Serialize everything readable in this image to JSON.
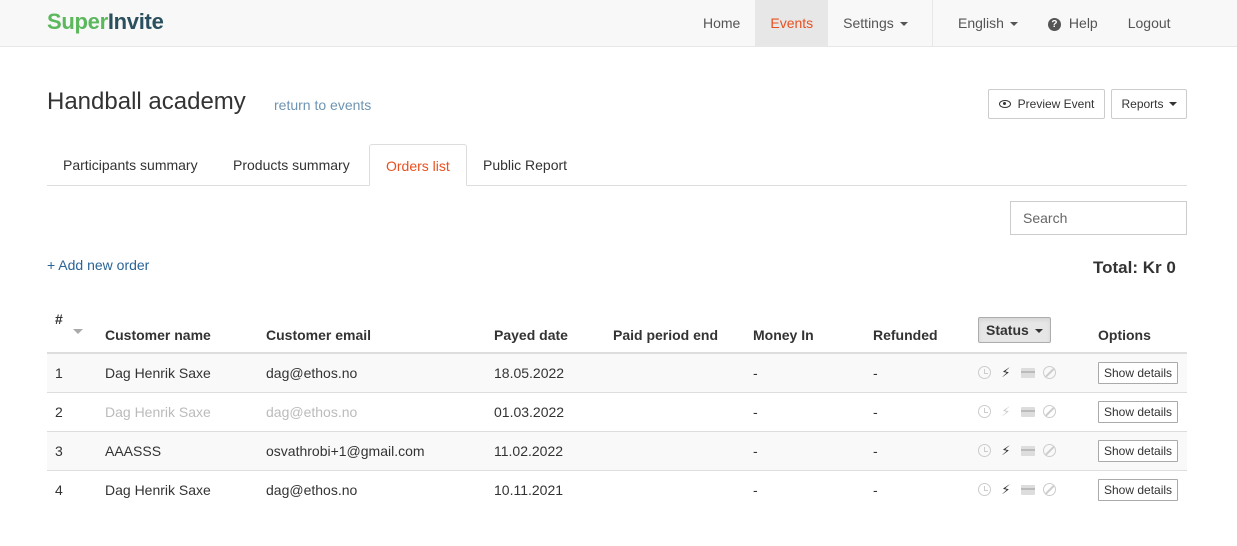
{
  "brand": {
    "part1": "Super",
    "part2": "Invite"
  },
  "nav": {
    "home": "Home",
    "events": "Events",
    "settings": "Settings",
    "language": "English",
    "help": "Help",
    "logout": "Logout"
  },
  "page": {
    "title": "Handball academy",
    "return_link": "return to events",
    "preview_button": "Preview Event",
    "reports_button": "Reports"
  },
  "tabs": [
    {
      "label": "Participants summary"
    },
    {
      "label": "Products summary"
    },
    {
      "label": "Orders list",
      "active": true
    },
    {
      "label": "Public Report"
    }
  ],
  "search": {
    "placeholder": "Search"
  },
  "add_order": "+ Add new order",
  "total": "Total: Kr 0",
  "table": {
    "headers": {
      "num": "#",
      "name": "Customer name",
      "email": "Customer email",
      "payed": "Payed date",
      "period": "Paid period end",
      "money": "Money In",
      "refunded": "Refunded",
      "status": "Status",
      "options": "Options"
    },
    "rows": [
      {
        "num": "1",
        "name": "Dag Henrik Saxe",
        "email": "dag@ethos.no",
        "payed": "18.05.2022",
        "period": "",
        "money": "-",
        "refunded": "-",
        "details": "Show details",
        "muted": false,
        "bolt_active": true
      },
      {
        "num": "2",
        "name": "Dag Henrik Saxe",
        "email": "dag@ethos.no",
        "payed": "01.03.2022",
        "period": "",
        "money": "-",
        "refunded": "-",
        "details": "Show details",
        "muted": true,
        "bolt_active": false
      },
      {
        "num": "3",
        "name": "AAASSS",
        "email": "osvathrobi+1@gmail.com",
        "payed": "11.02.2022",
        "period": "",
        "money": "-",
        "refunded": "-",
        "details": "Show details",
        "muted": false,
        "bolt_active": true
      },
      {
        "num": "4",
        "name": "Dag Henrik Saxe",
        "email": "dag@ethos.no",
        "payed": "10.11.2021",
        "period": "",
        "money": "-",
        "refunded": "-",
        "details": "Show details",
        "muted": false,
        "bolt_active": true
      }
    ]
  },
  "colors": {
    "accent": "#e8501f",
    "brand_green": "#5cb85c",
    "brand_dark": "#2a4f5e",
    "link": "#2a6496"
  }
}
